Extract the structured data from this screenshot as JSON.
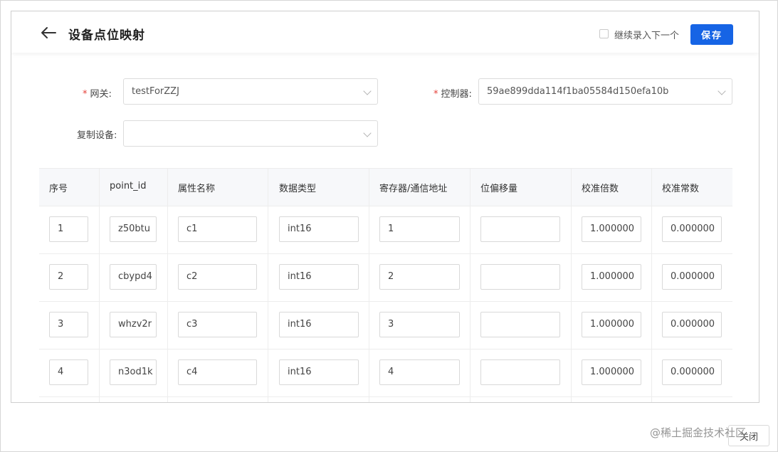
{
  "header": {
    "title": "设备点位映射",
    "continue_label": "继续录入下一个",
    "save_label": "保存"
  },
  "form": {
    "gateway_label": "网关:",
    "gateway_value": "testForZZJ",
    "controller_label": "控制器:",
    "controller_value": "59ae899dda114f1ba05584d150efa10b",
    "copy_device_label": "复制设备:",
    "copy_device_value": ""
  },
  "table": {
    "columns": [
      "序号",
      "point_id",
      "属性名称",
      "数据类型",
      "寄存器/通信地址",
      "位偏移量",
      "校准倍数",
      "校准常数"
    ],
    "rows": [
      {
        "index": "1",
        "point_id": "z50btu",
        "name": "c1",
        "type": "int16",
        "address": "1",
        "offset": "",
        "scale": "1.000000",
        "constant": "0.000000"
      },
      {
        "index": "2",
        "point_id": "cbypd4",
        "name": "c2",
        "type": "int16",
        "address": "2",
        "offset": "",
        "scale": "1.000000",
        "constant": "0.000000"
      },
      {
        "index": "3",
        "point_id": "whzv2r",
        "name": "c3",
        "type": "int16",
        "address": "3",
        "offset": "",
        "scale": "1.000000",
        "constant": "0.000000"
      },
      {
        "index": "4",
        "point_id": "n3od1k",
        "name": "c4",
        "type": "int16",
        "address": "4",
        "offset": "",
        "scale": "1.000000",
        "constant": "0.000000"
      }
    ]
  },
  "footer": {
    "close_label": "关闭",
    "watermark": "@稀土掘金技术社区"
  }
}
